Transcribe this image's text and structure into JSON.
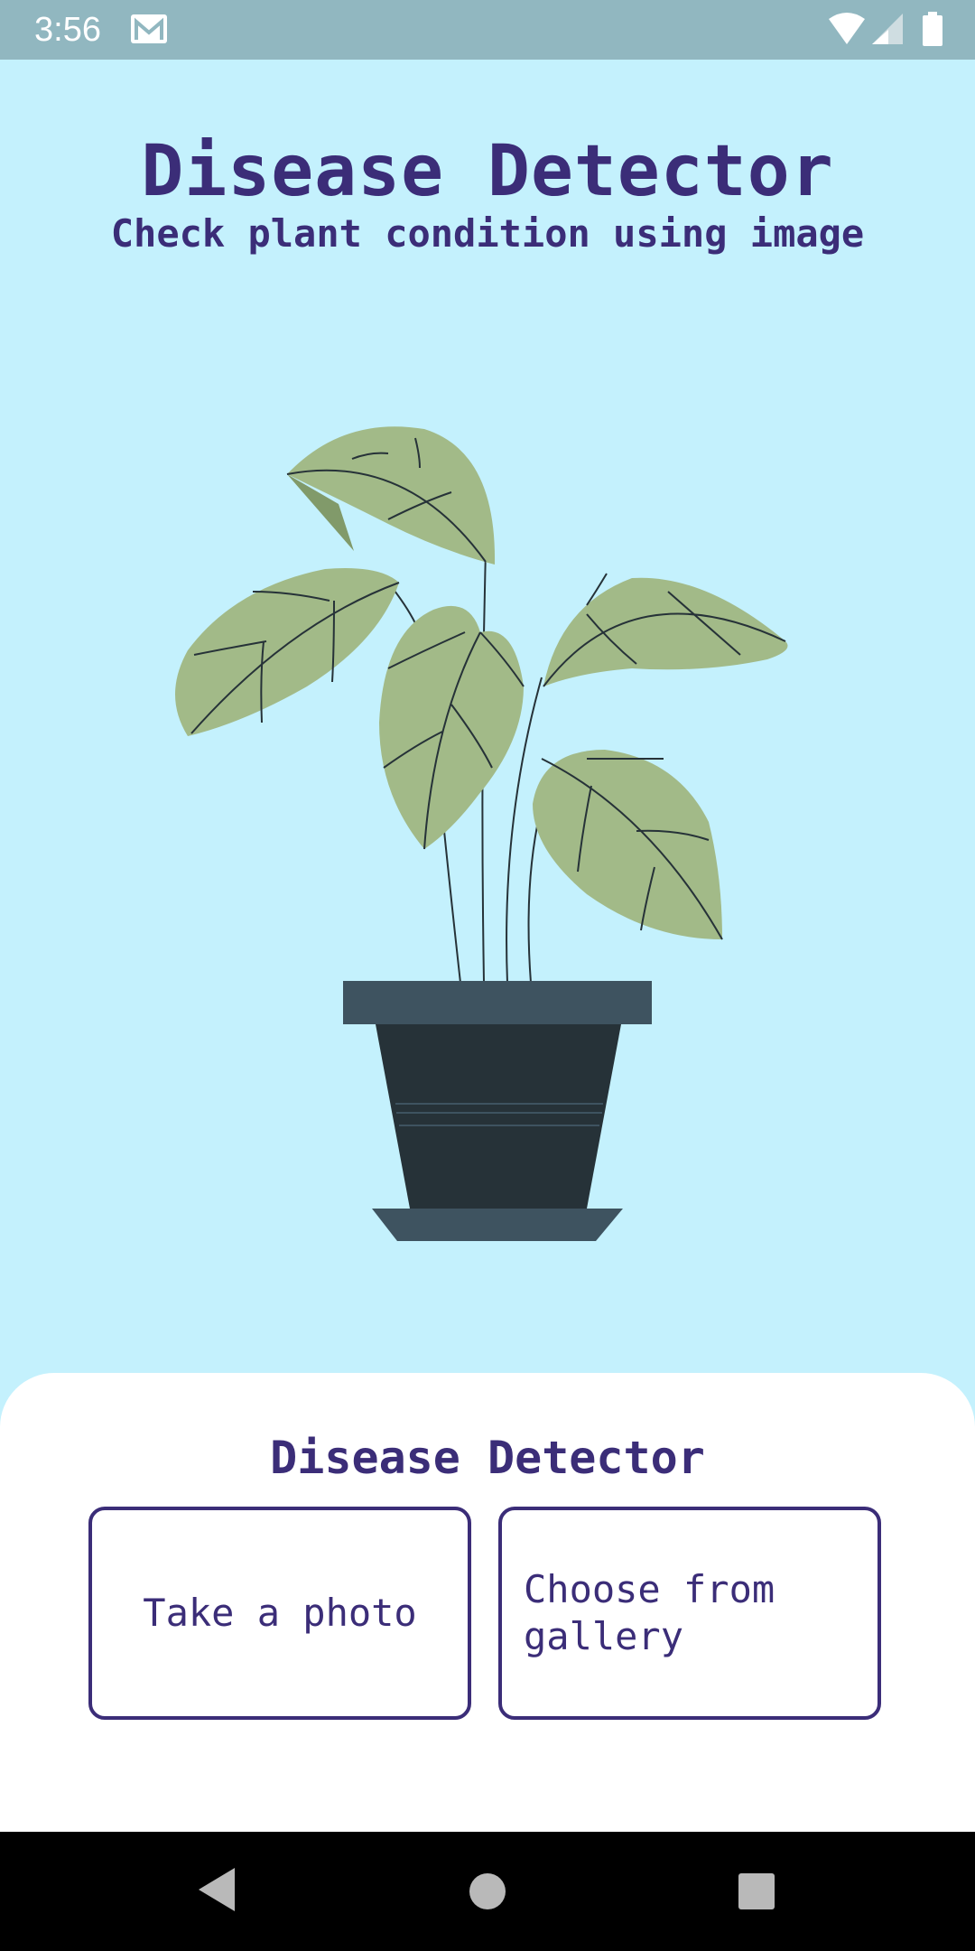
{
  "status_bar": {
    "time": "3:56",
    "icons": [
      "mail-icon",
      "wifi-icon",
      "signal-icon",
      "battery-icon"
    ]
  },
  "header": {
    "title": "Disease Detector",
    "subtitle": "Check plant condition using image"
  },
  "illustration": {
    "name": "potted-plant-illustration",
    "colors": {
      "leaf": "#a2ba88",
      "leaf_shadow": "#819a6a",
      "pot": "#263238",
      "pot_rim": "#3e5360",
      "background": "#c4f1fd"
    }
  },
  "sheet": {
    "title": "Disease Detector",
    "buttons": {
      "take_photo": "Take a photo",
      "choose_gallery": "Choose from gallery"
    }
  },
  "nav_bar": {
    "icons": [
      "back-icon",
      "home-icon",
      "recents-icon"
    ]
  },
  "colors": {
    "accent": "#3b2d78",
    "status_bar": "#91b7c0",
    "background": "#c4f1fd",
    "sheet": "#ffffff"
  }
}
